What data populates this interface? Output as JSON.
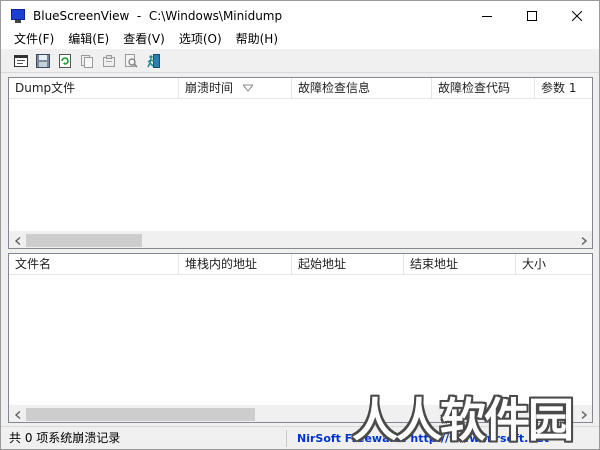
{
  "window": {
    "title": "BlueScreenView  -  C:\\Windows\\Minidump",
    "controls": [
      "minimize-icon",
      "maximize-icon",
      "close-icon"
    ]
  },
  "menu": {
    "items": [
      "文件(F)",
      "编辑(E)",
      "查看(V)",
      "选项(O)",
      "帮助(H)"
    ]
  },
  "toolbar": {
    "buttons": [
      "html-report-icon",
      "save-icon",
      "refresh-icon",
      "copy-icon",
      "properties-icon",
      "find-icon",
      "exit-icon"
    ]
  },
  "crash_list": {
    "columns": [
      "Dump文件",
      "崩溃时间",
      "故障检查信息",
      "故障检查代码",
      "参数 1"
    ],
    "sorted_column": "崩溃时间",
    "rows": []
  },
  "driver_list": {
    "columns": [
      "文件名",
      "堆栈内的地址",
      "起始地址",
      "结束地址",
      "大小"
    ],
    "rows": []
  },
  "status": {
    "count_text": "共 0 项系统崩溃记录",
    "link_text": "NirSoft Freeware.  http://www.nirsoft.net"
  },
  "watermark": {
    "text": "人人软件园"
  },
  "colors": {
    "link": "#0033cc",
    "app_icon": "#1a3fd1"
  }
}
